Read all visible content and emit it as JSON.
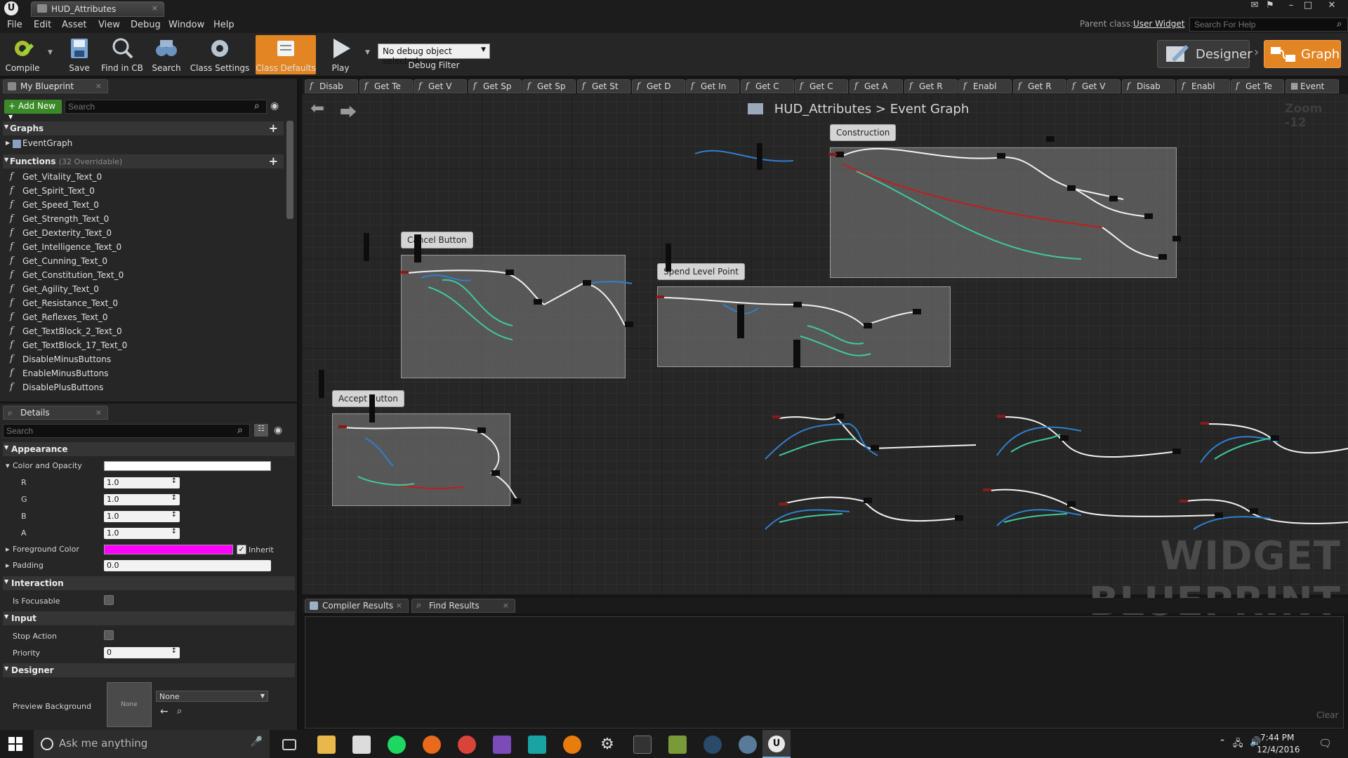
{
  "window": {
    "tab_title": "HUD_Attributes",
    "close_glyph": "×"
  },
  "menu": [
    "File",
    "Edit",
    "Asset",
    "View",
    "Debug",
    "Window",
    "Help"
  ],
  "parent_class": {
    "label": "Parent class:",
    "value": "User Widget"
  },
  "help_search": {
    "placeholder": "Search For Help"
  },
  "toolbar": {
    "compile": "Compile",
    "save": "Save",
    "find_in_cb": "Find in CB",
    "search": "Search",
    "class_settings": "Class Settings",
    "class_defaults": "Class Defaults",
    "play": "Play",
    "debug_select": "No debug object selected",
    "debug_filter": "Debug Filter"
  },
  "modes": {
    "designer": "Designer",
    "graph": "Graph"
  },
  "my_blueprint": {
    "tab": "My Blueprint",
    "add_new": "Add New",
    "search_placeholder": "Search",
    "graphs_header": "Graphs",
    "event_graph": "EventGraph",
    "functions_header": "Functions",
    "functions_count": "(32 Overridable)",
    "functions": [
      "Get_Vitality_Text_0",
      "Get_Spirit_Text_0",
      "Get_Speed_Text_0",
      "Get_Strength_Text_0",
      "Get_Dexterity_Text_0",
      "Get_Intelligence_Text_0",
      "Get_Cunning_Text_0",
      "Get_Constitution_Text_0",
      "Get_Agility_Text_0",
      "Get_Resistance_Text_0",
      "Get_Reflexes_Text_0",
      "Get_TextBlock_2_Text_0",
      "Get_TextBlock_17_Text_0",
      "DisableMinusButtons",
      "EnableMinusButtons",
      "DisablePlusButtons"
    ]
  },
  "details": {
    "tab": "Details",
    "search_placeholder": "Search",
    "appearance": "Appearance",
    "color_and_opacity": "Color and Opacity",
    "r_label": "R",
    "r_value": "1.0",
    "g_label": "G",
    "g_value": "1.0",
    "b_label": "B",
    "b_value": "1.0",
    "a_label": "A",
    "a_value": "1.0",
    "foreground_color": "Foreground Color",
    "foreground_hex": "#ff00ff",
    "inherit": "Inherit",
    "padding": "Padding",
    "padding_value": "0.0",
    "interaction": "Interaction",
    "is_focusable": "Is Focusable",
    "input": "Input",
    "stop_action": "Stop Action",
    "priority": "Priority",
    "priority_value": "0",
    "designer": "Designer",
    "preview_background": "Preview Background",
    "preview_swatch": "None",
    "preview_select": "None"
  },
  "graph_tabs": [
    "Disab",
    "Get Te",
    "Get V",
    "Get Sp",
    "Get Sp",
    "Get St",
    "Get D",
    "Get In",
    "Get C",
    "Get C",
    "Get A",
    "Get R",
    "Enabl",
    "Get R",
    "Get V",
    "Disab",
    "Enabl",
    "Get Te",
    "Event"
  ],
  "graph": {
    "breadcrumb_root": "HUD_Attributes",
    "breadcrumb_sep": ">",
    "breadcrumb_leaf": "Event Graph",
    "zoom": "Zoom -12",
    "comments": {
      "construction": "Construction",
      "cancel": "Cancel Button",
      "spend": "Spend Level Point",
      "accept": "Accept Button"
    },
    "watermark": "WIDGET BLUEPRINT"
  },
  "bottom": {
    "compiler_results": "Compiler Results",
    "find_results": "Find Results",
    "clear": "Clear"
  },
  "taskbar": {
    "cortana": "Ask me anything",
    "time": "7:44 PM",
    "date": "12/4/2016"
  },
  "colors": {
    "accent_orange": "#e28522",
    "add_green": "#3b8a28",
    "wire_teal": "#3ec9a0",
    "wire_blue": "#2f7fd0",
    "wire_red": "#a11a1a"
  }
}
